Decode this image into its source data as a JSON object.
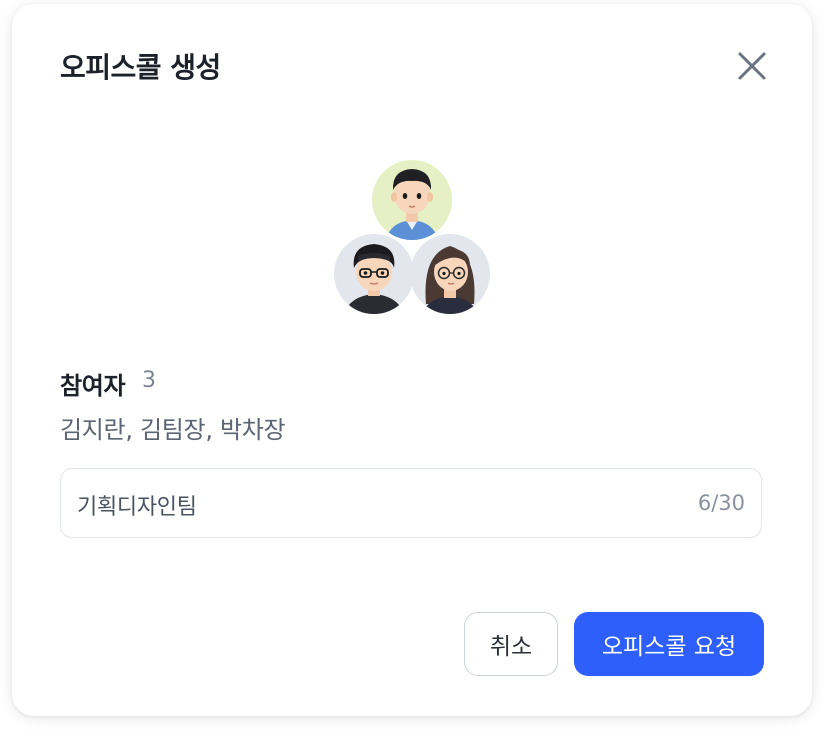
{
  "dialog": {
    "title": "오피스콜 생성",
    "close_icon": "close-icon"
  },
  "avatars": [
    {
      "name": "avatar-man-short-hair",
      "bg": "#e6f0c4"
    },
    {
      "name": "avatar-man-glasses",
      "bg": "#e3e6ec"
    },
    {
      "name": "avatar-woman-glasses",
      "bg": "#e3e6ec"
    }
  ],
  "participants": {
    "label": "참여자",
    "count": "3",
    "names": "김지란, 김팀장, 박차장"
  },
  "name_input": {
    "value": "기획디자인팀",
    "counter": "6/30"
  },
  "actions": {
    "cancel_label": "취소",
    "request_label": "오피스콜 요청"
  },
  "colors": {
    "primary": "#2f5ffb",
    "title_text": "#1d2129",
    "muted_text": "#7c8494",
    "border": "#e2e5ea"
  }
}
